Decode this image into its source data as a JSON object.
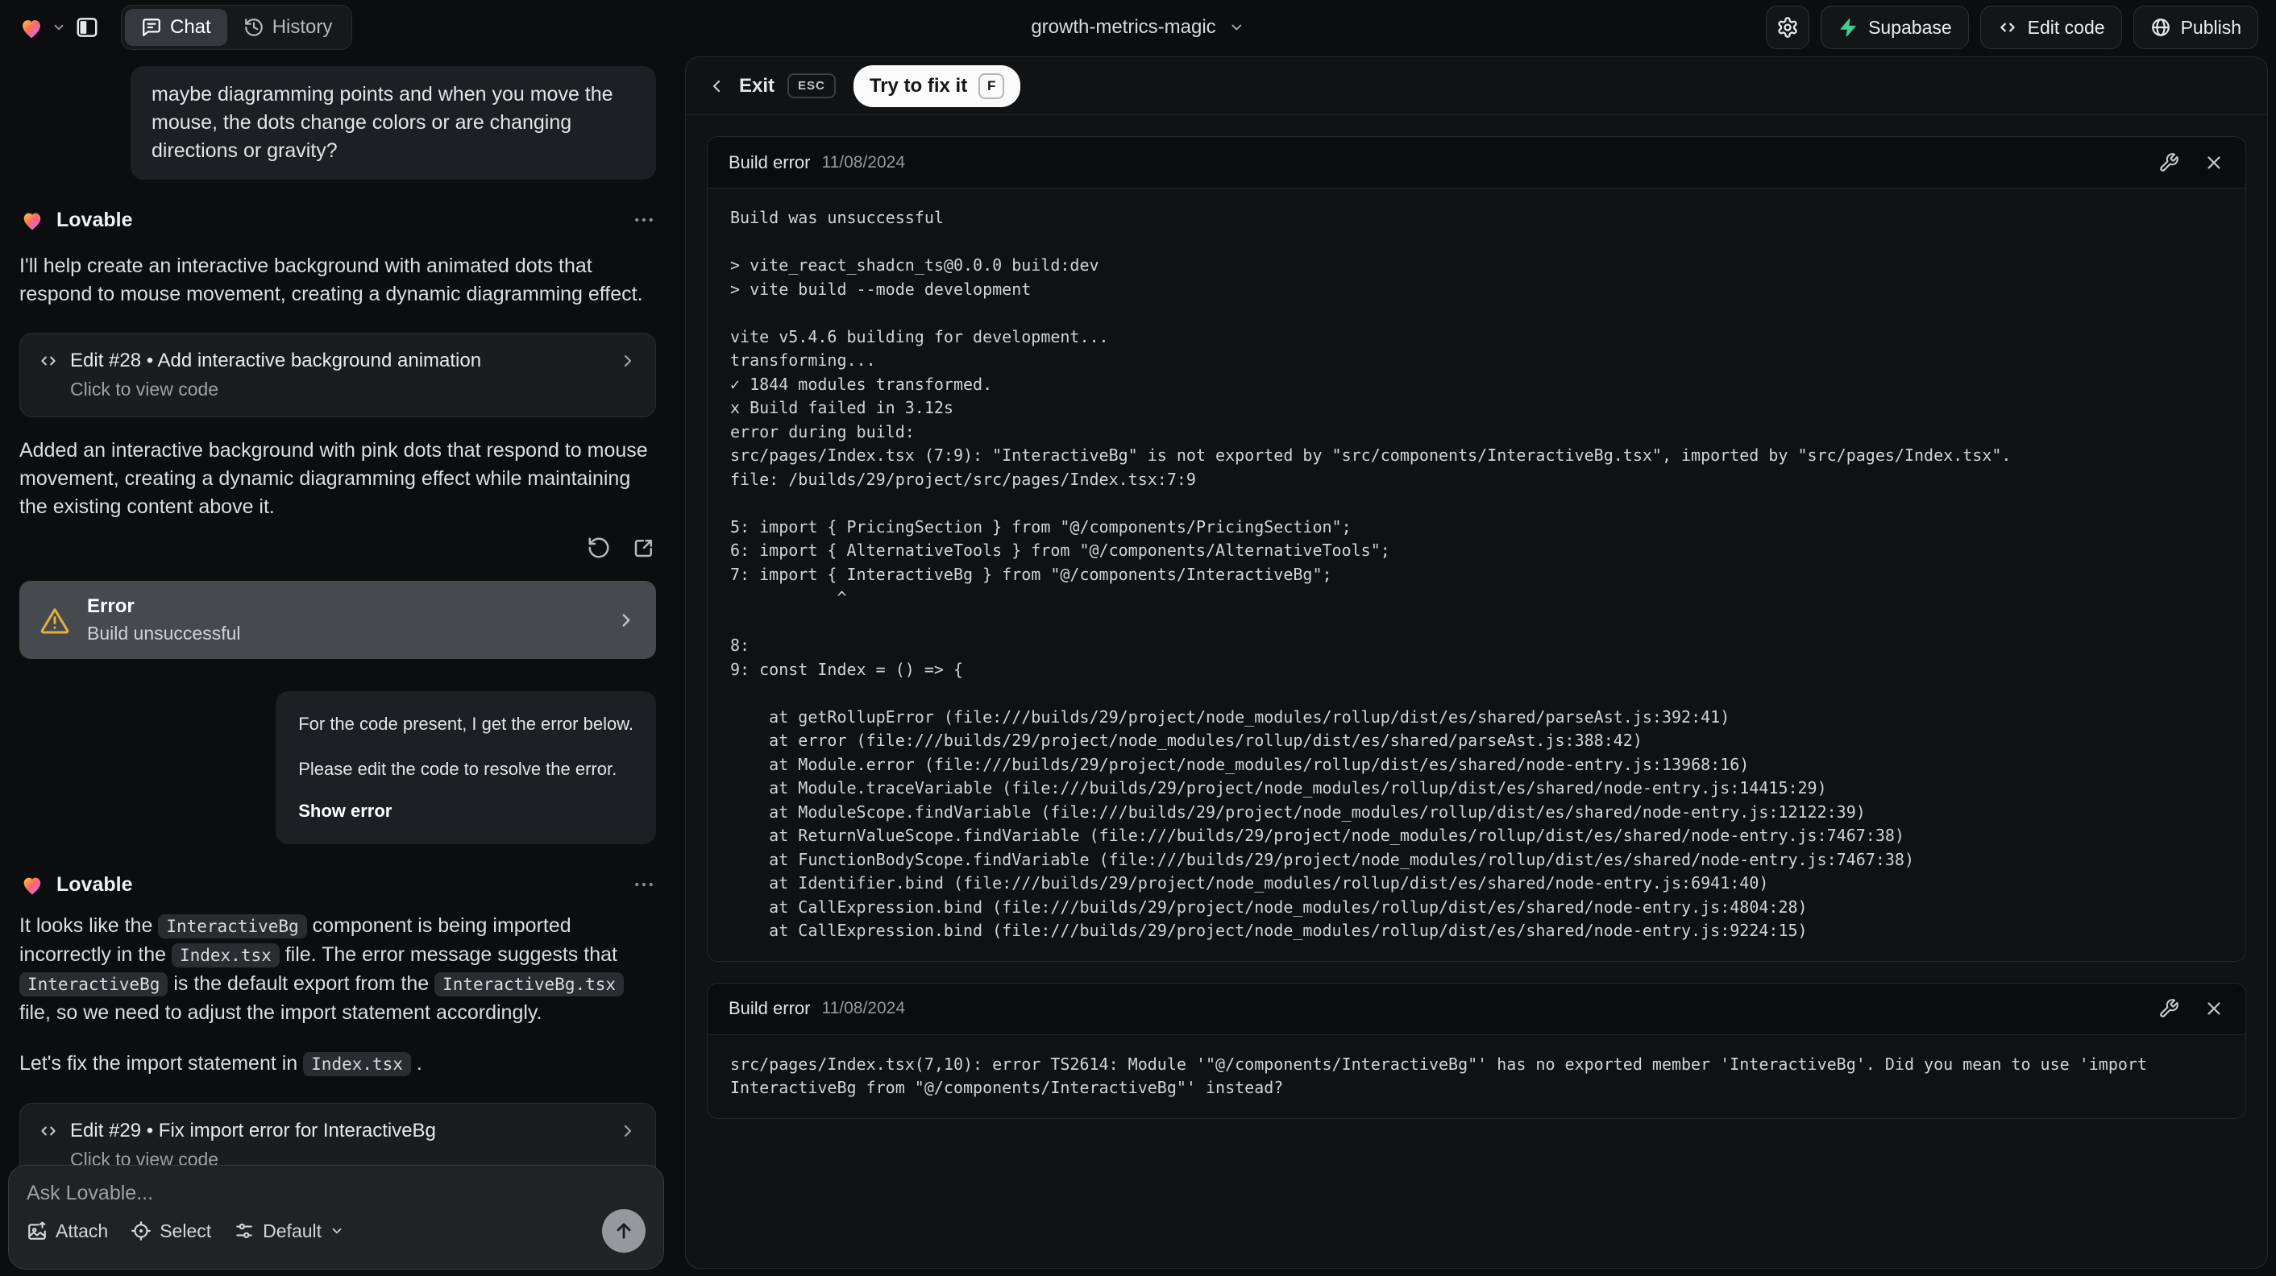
{
  "topbar": {
    "project": "growth-metrics-magic",
    "tab_chat": "Chat",
    "tab_history": "History",
    "supabase": "Supabase",
    "edit_code": "Edit code",
    "publish": "Publish"
  },
  "colors": {
    "supabase_green": "#3ecf8e",
    "warning": "#e0b13d"
  },
  "chat": {
    "assistant": "Lovable",
    "bubble1": "maybe diagramming points and when you move the mouse, the dots change colors or are changing directions or gravity?",
    "reply1": "I'll help create an interactive background with animated dots that respond to mouse movement, creating a dynamic diagramming effect.",
    "card28": {
      "title": "Edit #28 • Add interactive background animation",
      "subtitle": "Click to view code"
    },
    "reply1b": "Added an interactive background with pink dots that respond to mouse movement, creating a dynamic diagramming effect while maintaining the existing content above it.",
    "error_card": {
      "title": "Error",
      "subtitle": "Build unsuccessful"
    },
    "bubble2": {
      "line1": "For the code present, I get the error below.",
      "line2": "Please edit the code to resolve the error.",
      "action": "Show error"
    },
    "reply2": [
      "It looks like the ",
      "InteractiveBg",
      " component is being imported incorrectly in the ",
      "Index.tsx",
      " file. The error message suggests that ",
      "InteractiveBg",
      " is the default export from the ",
      "InteractiveBg.tsx",
      " file, so we need to adjust the import statement accordingly."
    ],
    "reply2b": [
      "Let's fix the import statement in ",
      "Index.tsx",
      " ."
    ],
    "card29": {
      "title": "Edit #29 • Fix import error for InteractiveBg",
      "subtitle": "Click to view code"
    },
    "composer": {
      "placeholder": "Ask Lovable...",
      "attach": "Attach",
      "select": "Select",
      "mode": "Default"
    }
  },
  "panel": {
    "exit": "Exit",
    "esc_key": "ESC",
    "fix_label": "Try to fix it",
    "fix_key": "F",
    "errors": [
      {
        "title": "Build error",
        "date": "11/08/2024",
        "log": "Build was unsuccessful\n\n> vite_react_shadcn_ts@0.0.0 build:dev\n> vite build --mode development\n\nvite v5.4.6 building for development...\ntransforming...\n✓ 1844 modules transformed.\nx Build failed in 3.12s\nerror during build:\nsrc/pages/Index.tsx (7:9): \"InteractiveBg\" is not exported by \"src/components/InteractiveBg.tsx\", imported by \"src/pages/Index.tsx\".\nfile: /builds/29/project/src/pages/Index.tsx:7:9\n\n5: import { PricingSection } from \"@/components/PricingSection\";\n6: import { AlternativeTools } from \"@/components/AlternativeTools\";\n7: import { InteractiveBg } from \"@/components/InteractiveBg\";\n           ^\n\n8: \n9: const Index = () => {\n\n    at getRollupError (file:///builds/29/project/node_modules/rollup/dist/es/shared/parseAst.js:392:41)\n    at error (file:///builds/29/project/node_modules/rollup/dist/es/shared/parseAst.js:388:42)\n    at Module.error (file:///builds/29/project/node_modules/rollup/dist/es/shared/node-entry.js:13968:16)\n    at Module.traceVariable (file:///builds/29/project/node_modules/rollup/dist/es/shared/node-entry.js:14415:29)\n    at ModuleScope.findVariable (file:///builds/29/project/node_modules/rollup/dist/es/shared/node-entry.js:12122:39)\n    at ReturnValueScope.findVariable (file:///builds/29/project/node_modules/rollup/dist/es/shared/node-entry.js:7467:38)\n    at FunctionBodyScope.findVariable (file:///builds/29/project/node_modules/rollup/dist/es/shared/node-entry.js:7467:38)\n    at Identifier.bind (file:///builds/29/project/node_modules/rollup/dist/es/shared/node-entry.js:6941:40)\n    at CallExpression.bind (file:///builds/29/project/node_modules/rollup/dist/es/shared/node-entry.js:4804:28)\n    at CallExpression.bind (file:///builds/29/project/node_modules/rollup/dist/es/shared/node-entry.js:9224:15)"
      },
      {
        "title": "Build error",
        "date": "11/08/2024",
        "log": "src/pages/Index.tsx(7,10): error TS2614: Module '\"@/components/InteractiveBg\"' has no exported member 'InteractiveBg'. Did you mean to use 'import InteractiveBg from \"@/components/InteractiveBg\"' instead?"
      }
    ]
  }
}
